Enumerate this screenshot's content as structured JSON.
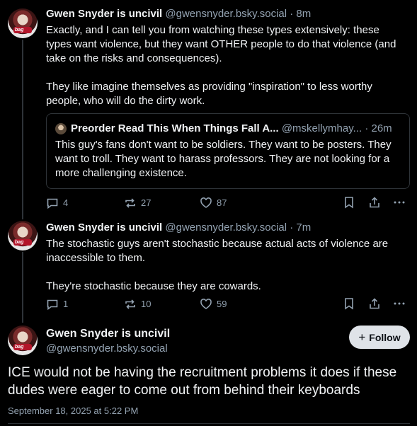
{
  "posts": [
    {
      "author_name": "Gwen Snyder is uncivil",
      "author_handle": "@gwensnyder.bsky.social",
      "time": "· 8m",
      "paragraphs": [
        "Exactly, and I can tell you from watching these types extensively: these types want violence, but they want OTHER people to do that violence (and take on the risks and consequences).",
        "They like imagine themselves as providing \"inspiration\" to less worthy people, who will do the dirty work."
      ],
      "quote": {
        "author_name": "Preorder Read This When Things Fall A...",
        "author_handle": "@mskellymhay...",
        "time": "· 26m",
        "text": "This guy's fans don't want to be soldiers. They want to be posters. They want to troll. They want to harass professors. They are not looking for a more challenging existence."
      },
      "counts": {
        "replies": "4",
        "reposts": "27",
        "likes": "87"
      }
    },
    {
      "author_name": "Gwen Snyder is uncivil",
      "author_handle": "@gwensnyder.bsky.social",
      "time": "· 7m",
      "paragraphs": [
        "The stochastic guys aren't stochastic because actual acts of violence are inaccessible to them.",
        "They're stochastic because they are cowards."
      ],
      "counts": {
        "replies": "1",
        "reposts": "10",
        "likes": "59"
      }
    }
  ],
  "main_post": {
    "author_name": "Gwen Snyder is uncivil",
    "author_handle": "@gwensnyder.bsky.social",
    "follow_label": "Follow",
    "follow_icon": "+",
    "text": "ICE would not be having the recruitment problems it does if these dudes were eager to come out from behind their keyboards",
    "timestamp": "September 18, 2025 at 5:22 PM"
  },
  "avatar_badge": "bag",
  "icons": [
    "reply-icon",
    "repost-icon",
    "like-icon",
    "bookmark-icon",
    "share-icon",
    "more-icon"
  ],
  "colors": {
    "background": "#000000",
    "text": "#f1f3f5",
    "muted": "#93a2b1",
    "border": "#2e3338",
    "follow_bg": "#dfe3e8"
  }
}
